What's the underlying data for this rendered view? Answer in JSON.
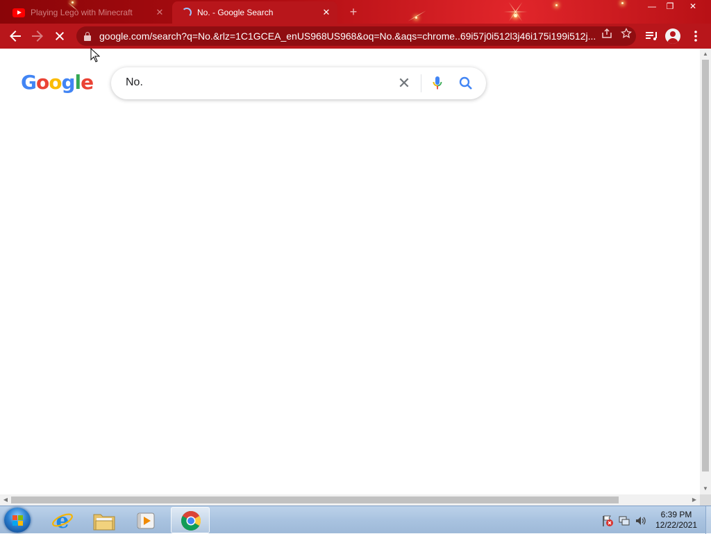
{
  "browser": {
    "tabs": [
      {
        "title": "Playing Lego with Minecraft",
        "icon": "youtube-icon",
        "active": false
      },
      {
        "title": "No. - Google Search",
        "icon": "loading-spinner-icon",
        "active": true
      }
    ],
    "close_tab_glyph": "✕",
    "new_tab_glyph": "+",
    "window_controls": {
      "minimize": "—",
      "restore": "❐",
      "close": "✕"
    },
    "address_bar": {
      "url": "google.com/search?q=No.&rlz=1C1GCEA_enUS968US968&oq=No.&aqs=chrome..69i57j0i512l3j46i175i199i512j..."
    },
    "theme_color": "#b8161b"
  },
  "google": {
    "logo_letters": [
      "G",
      "o",
      "o",
      "g",
      "l",
      "e"
    ],
    "logo_colors": [
      "#4285f4",
      "#ea4335",
      "#fbbc05",
      "#4285f4",
      "#34a853",
      "#ea4335"
    ],
    "search": {
      "query": "No.",
      "clear_glyph": "✕"
    }
  },
  "taskbar": {
    "pinned": [
      {
        "name": "internet-explorer-icon"
      },
      {
        "name": "file-explorer-icon"
      },
      {
        "name": "media-player-icon"
      },
      {
        "name": "chrome-icon",
        "active": true
      }
    ],
    "time": "6:39 PM",
    "date": "12/22/2021"
  }
}
